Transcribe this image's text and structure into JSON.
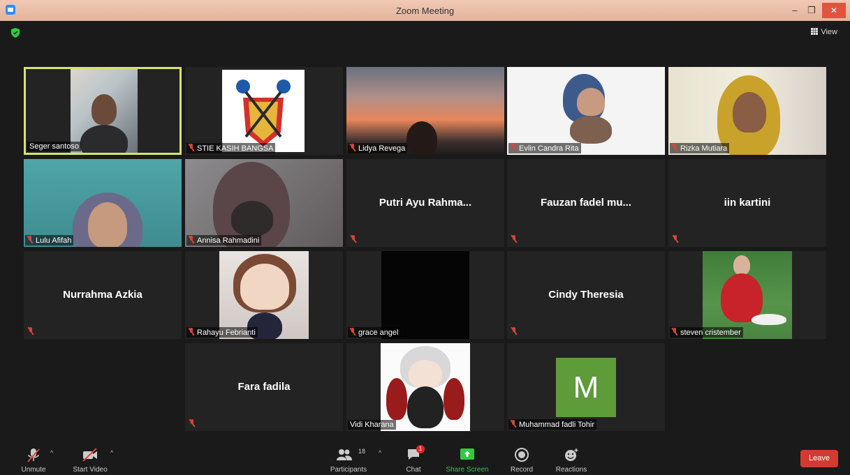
{
  "window": {
    "title": "Zoom Meeting",
    "min_glyph": "–",
    "max_glyph": "❐",
    "close_glyph": "✕"
  },
  "view_button": {
    "label": "View",
    "icon": "grid-icon"
  },
  "tiles": [
    {
      "name": "Seger santoso",
      "active": true,
      "video": "room",
      "muted": false
    },
    {
      "name": "STIE KASIH BANGSA",
      "video": "logo",
      "muted": true
    },
    {
      "name": "Lidya Revega",
      "video": "sunset",
      "muted": true
    },
    {
      "name": "Evlin Candra Rita",
      "video": "white",
      "muted": true
    },
    {
      "name": "Rizka Mutiara",
      "video": "curtain",
      "muted": true
    },
    {
      "name": "Lulu Afifah",
      "video": "teal",
      "muted": true
    },
    {
      "name": "Annisa Rahmadini",
      "video": "grey",
      "muted": true
    },
    {
      "name": "Putri Ayu Rahma...",
      "video": "none",
      "muted": true
    },
    {
      "name": "Fauzan fadel mu...",
      "video": "none",
      "muted": true
    },
    {
      "name": "iin kartini",
      "video": "none",
      "muted": true
    },
    {
      "name": "Nurrahma Azkia",
      "video": "none",
      "muted": true
    },
    {
      "name": "Rahayu Febrianti",
      "video": "doll",
      "muted": true
    },
    {
      "name": "grace angel",
      "video": "black",
      "muted": true
    },
    {
      "name": "Cindy Theresia",
      "video": "none",
      "muted": true
    },
    {
      "name": "steven cristember",
      "video": "field",
      "muted": true
    },
    {
      "name": "Fara fadila",
      "video": "none",
      "muted": true
    },
    {
      "name": "Vidi Kharana",
      "video": "anime",
      "muted": false
    },
    {
      "name": "Muhammad fadli Tohir",
      "video": "avatar",
      "avatar_letter": "M",
      "muted": true
    }
  ],
  "toolbar": {
    "unmute": "Unmute",
    "start_video": "Start Video",
    "participants": "Participants",
    "participants_count": "18",
    "chat": "Chat",
    "chat_badge": "1",
    "share_screen": "Share Screen",
    "record": "Record",
    "reactions": "Reactions",
    "leave": "Leave"
  },
  "colors": {
    "accent_green": "#2ecc40",
    "leave_red": "#d13b32",
    "active_border": "#d7e36f",
    "avatar_green": "#5e9c3a"
  }
}
